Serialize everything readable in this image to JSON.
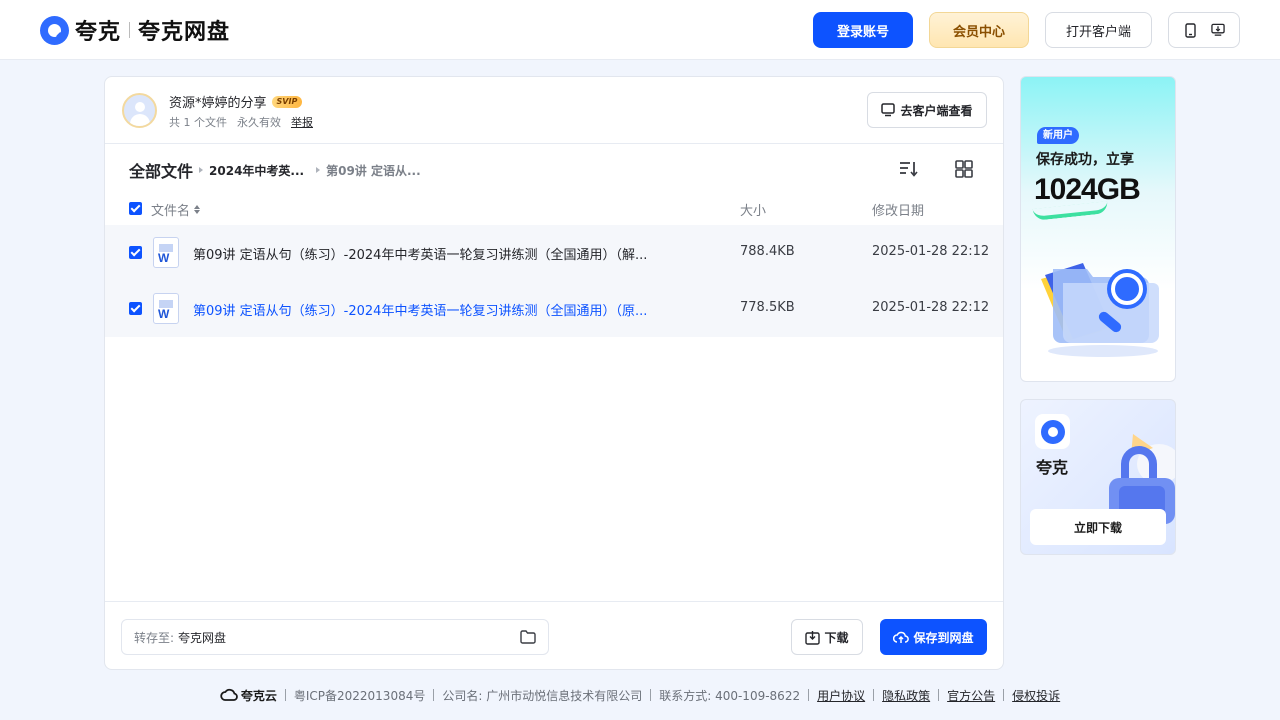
{
  "header": {
    "brand_name": "夸克",
    "brand_product": "夸克网盘",
    "login_label": "登录账号",
    "vip_label": "会员中心",
    "open_client_label": "打开客户端"
  },
  "share": {
    "title": "资源*婷婷的分享",
    "badge": "SVIP",
    "file_count": "共 1 个文件",
    "validity": "永久有效",
    "report": "举报",
    "view_in_client": "去客户端查看"
  },
  "breadcrumb": {
    "root": "全部文件",
    "mid": "2024年中考英...",
    "current": "第09讲 定语从..."
  },
  "table": {
    "col_name": "文件名",
    "col_size": "大小",
    "col_date": "修改日期",
    "rows": [
      {
        "name": "第09讲 定语从句（练习）-2024年中考英语一轮复习讲练测（全国通用）（解...",
        "size": "788.4KB",
        "date": "2025-01-28 22:12"
      },
      {
        "name": "第09讲 定语从句（练习）-2024年中考英语一轮复习讲练测（全国通用）（原...",
        "size": "778.5KB",
        "date": "2025-01-28 22:12"
      }
    ]
  },
  "footer_bar": {
    "save_to_label": "转存至:",
    "save_to_value": "夸克网盘",
    "download_label": "下载",
    "save_label": "保存到网盘"
  },
  "ad1": {
    "tag": "新用户",
    "line1": "保存成功，立享",
    "big": "1024GB"
  },
  "ad2": {
    "name": "夸克",
    "button": "立即下载"
  },
  "site_footer": {
    "logo_text": "夸克云",
    "icp": "粤ICP备2022013084号",
    "company": "公司名: 广州市动悦信息技术有限公司",
    "contact": "联系方式: 400-109-8622",
    "links": [
      "用户协议",
      "隐私政策",
      "官方公告",
      "侵权投诉"
    ]
  },
  "colors": {
    "primary": "#0d53ff",
    "brand": "#2f6bff",
    "vip_text": "#8a4f00"
  }
}
